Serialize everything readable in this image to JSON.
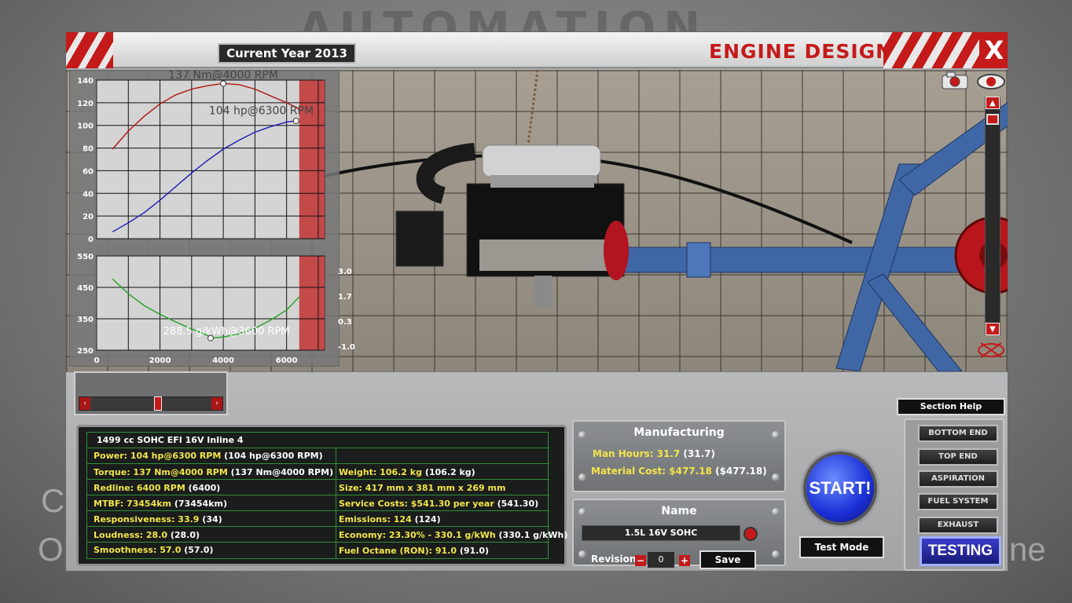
{
  "window": {
    "current_year": "Current Year 2013",
    "title": "ENGINE DESIGN",
    "close_label": "X"
  },
  "background": {
    "logo_text": "AUTOMATION",
    "left_letter_1": "C",
    "left_letter_2": "O",
    "right_word": "ne"
  },
  "colors": {
    "accent_red": "#c41a1a",
    "stat_yellow": "#f3e54b",
    "grid_green": "#2e8f3a",
    "torque_line": "#b21414",
    "power_line": "#1a1ab8",
    "economy_line": "#22a022"
  },
  "chart_data": [
    {
      "type": "line",
      "x": [
        500,
        1000,
        1500,
        2000,
        2500,
        3000,
        3500,
        4000,
        4500,
        5000,
        5500,
        6000,
        6300,
        6400
      ],
      "series": [
        {
          "values": [
            79,
            95,
            108,
            119,
            127,
            132,
            135,
            137,
            136,
            132,
            126,
            120,
            116,
            114
          ]
        },
        {
          "values": [
            6,
            14,
            23,
            34,
            46,
            58,
            69,
            79,
            87,
            94,
            99,
            103,
            104,
            103
          ]
        }
      ],
      "annotations": [
        "137 Nm@4000 RPM",
        "104 hp@6300 RPM"
      ],
      "y_ticks": [
        "140",
        "120",
        "100",
        "80",
        "60",
        "40",
        "20",
        "0"
      ],
      "ylim": [
        0,
        140
      ],
      "xlim": [
        0,
        7200
      ],
      "redline_from": 6400,
      "grid": true
    },
    {
      "type": "line",
      "x": [
        500,
        1000,
        1500,
        2000,
        2500,
        3000,
        3500,
        3600,
        4000,
        4500,
        5000,
        5500,
        6000,
        6400
      ],
      "series": [
        {
          "values": [
            477,
            430,
            392,
            364,
            340,
            318,
            297,
            288.5,
            292,
            302,
            320,
            346,
            378,
            420
          ]
        }
      ],
      "annotations": [
        "288.5 g/kWh@3600 RPM"
      ],
      "y_ticks": [
        "550",
        "450",
        "350",
        "250"
      ],
      "x_ticks": [
        "0",
        "2000",
        "4000",
        "6000"
      ],
      "right_ticks": [
        "3.0",
        "1.7",
        "0.3",
        "-1.0"
      ],
      "ylim": [
        250,
        550
      ],
      "xlim": [
        0,
        7200
      ],
      "redline_from": 6400,
      "grid": true
    }
  ],
  "stats": {
    "engine_name": "1499 cc SOHC EFI 16V Inline 4",
    "left": [
      {
        "label": "Power: 104 hp@6300 RPM",
        "extra": "(104 hp@6300 RPM)"
      },
      {
        "label": "Torque: 137 Nm@4000 RPM",
        "extra": "(137 Nm@4000 RPM)"
      },
      {
        "label": "Redline: 6400 RPM",
        "extra": "(6400)"
      },
      {
        "label": "MTBF: 73454km",
        "extra": "(73454km)"
      },
      {
        "label": "Responsiveness: 33.9",
        "extra": "(34)"
      },
      {
        "label": "Loudness: 28.0",
        "extra": "(28.0)"
      },
      {
        "label": "Smoothness: 57.0",
        "extra": "(57.0)"
      }
    ],
    "right": [
      {
        "label": "Weight: 106.2 kg",
        "extra": "(106.2 kg)"
      },
      {
        "label": "Size: 417 mm x 381 mm x 269 mm",
        "extra": ""
      },
      {
        "label": "Service Costs: $541.30 per year",
        "extra": "(541.30)"
      },
      {
        "label": "Emissions: 124",
        "extra": "(124)"
      },
      {
        "label": "Economy: 23.30% - 330.1 g/kWh",
        "extra": "(330.1 g/kWh)"
      },
      {
        "label": "Fuel Octane (RON): 91.0",
        "extra": "(91.0)"
      }
    ]
  },
  "manufacturing": {
    "title": "Manufacturing",
    "man_hours": "Man Hours: 31.7",
    "man_hours_extra": "(31.7)",
    "material_cost": "Material Cost: $477.18",
    "material_cost_extra": "($477.18)"
  },
  "name_panel": {
    "title": "Name",
    "value": "1.5L 16V SOHC",
    "revision_label": "Revision",
    "revision_value": "0",
    "minus": "−",
    "plus": "+",
    "save_label": "Save"
  },
  "actions": {
    "start_label": "START!",
    "test_mode_label": "Test Mode",
    "section_help_label": "Section Help",
    "testing_label": "TESTING"
  },
  "nav": {
    "items": [
      "BOTTOM END",
      "TOP END",
      "ASPIRATION",
      "FUEL SYSTEM",
      "EXHAUST"
    ]
  },
  "controls": {
    "arrow_left": "‹",
    "arrow_right": "›",
    "zoom_up": "▲",
    "zoom_down": "▼"
  }
}
